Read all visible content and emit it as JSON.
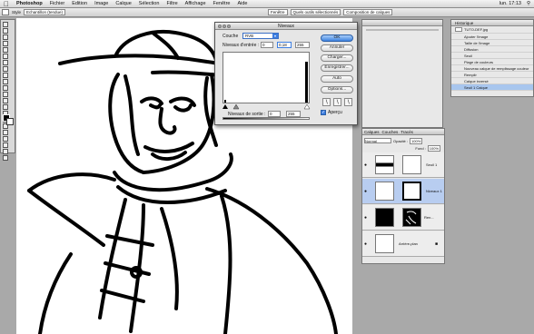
{
  "menubar": {
    "apple": "",
    "app": "Photoshop",
    "items": [
      "Fichier",
      "Edition",
      "Image",
      "Calque",
      "Sélection",
      "Filtre",
      "Affichage",
      "Fenêtre",
      "Aide"
    ],
    "clock": "lun. 17:13"
  },
  "options": {
    "style_label": "Style",
    "style_value": "Echantillon (tendue)",
    "tab1": "Fenêtre",
    "tab2": "Quels outils sélectionnés",
    "tab3": "Composition de calques"
  },
  "levels": {
    "title": "Niveaux",
    "channel_label": "Couche",
    "channel_value": "RVB",
    "input_label": "Niveaux d'entrée :",
    "input_black": "0",
    "input_gamma": "0,18",
    "input_white": "255",
    "output_label": "Niveaux de sortie :",
    "output_black": "0",
    "output_white": "255",
    "ok": "OK",
    "cancel": "Annuler",
    "load": "Charger...",
    "save": "Enregistrer...",
    "auto": "Auto",
    "options": "Options...",
    "preview": "Aperçu"
  },
  "history": {
    "title": "Historique",
    "snapshot": "TUTO-DEF.jpg",
    "items": [
      "Ajouter l'image",
      "Taille de l'image",
      "Diffusion",
      "Seuil",
      "Plage de couleurs",
      "Nouveau calque de remplissage couleur",
      "Remplir",
      "Calque inversé",
      "Seuil 1 Calque"
    ]
  },
  "layers": {
    "tabs": [
      "Calques",
      "Couches",
      "Tracés"
    ],
    "blend": "Normal",
    "opacity_label": "Opacité :",
    "opacity": "100%",
    "fill_label": "Fond :",
    "fill": "100%",
    "items": [
      {
        "name": "Seuil 1"
      },
      {
        "name": "Niveaux 1"
      },
      {
        "name": "Ren..."
      },
      {
        "name": "Arrière-plan"
      }
    ]
  },
  "colors": {
    "accent": "#3c7de0",
    "selected": "#b8cdf0"
  }
}
